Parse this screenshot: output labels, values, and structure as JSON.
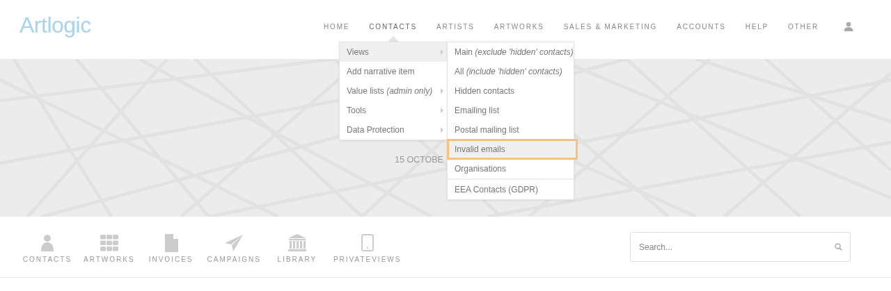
{
  "logo": "Artlogic",
  "nav": [
    {
      "label": "HOME",
      "selected": false
    },
    {
      "label": "CONTACTS",
      "selected": true
    },
    {
      "label": "ARTISTS",
      "selected": false
    },
    {
      "label": "ARTWORKS",
      "selected": false
    },
    {
      "label": "SALES & MARKETING",
      "selected": false
    },
    {
      "label": "ACCOUNTS",
      "selected": false
    },
    {
      "label": "HELP",
      "selected": false
    },
    {
      "label": "OTHER",
      "selected": false
    }
  ],
  "hero": {
    "date": "15 OCTOBE"
  },
  "menu": [
    {
      "label": "Views",
      "has_submenu": true,
      "selected": true
    },
    {
      "label": "Add narrative item",
      "has_submenu": false,
      "selected": false
    },
    {
      "label": "Value lists *(admin only)*",
      "has_submenu": true,
      "selected": false
    },
    {
      "label": "Tools",
      "has_submenu": true,
      "selected": false
    },
    {
      "label": "Data Protection",
      "has_submenu": true,
      "selected": false
    }
  ],
  "submenu": [
    {
      "label": "Main *(exclude 'hidden' contacts)*",
      "highlighted": false,
      "divider_before": false
    },
    {
      "label": "All *(include 'hidden' contacts)*",
      "highlighted": false,
      "divider_before": false
    },
    {
      "label": "Hidden contacts",
      "highlighted": false,
      "divider_before": false
    },
    {
      "label": "Emailing list",
      "highlighted": false,
      "divider_before": false
    },
    {
      "label": "Postal mailing list",
      "highlighted": false,
      "divider_before": false
    },
    {
      "label": "Invalid emails",
      "highlighted": true,
      "divider_before": false
    },
    {
      "label": "Organisations",
      "highlighted": false,
      "divider_before": false
    },
    {
      "label": "EEA Contacts (GDPR)",
      "highlighted": false,
      "divider_before": true
    }
  ],
  "shortcuts": [
    {
      "label": "CONTACTS"
    },
    {
      "label": "ARTWORKS"
    },
    {
      "label": "INVOICES"
    },
    {
      "label": "CAMPAIGNS"
    },
    {
      "label": "LIBRARY"
    },
    {
      "label": "PRIVATEVIEWS"
    }
  ],
  "search": {
    "placeholder": "Search..."
  }
}
